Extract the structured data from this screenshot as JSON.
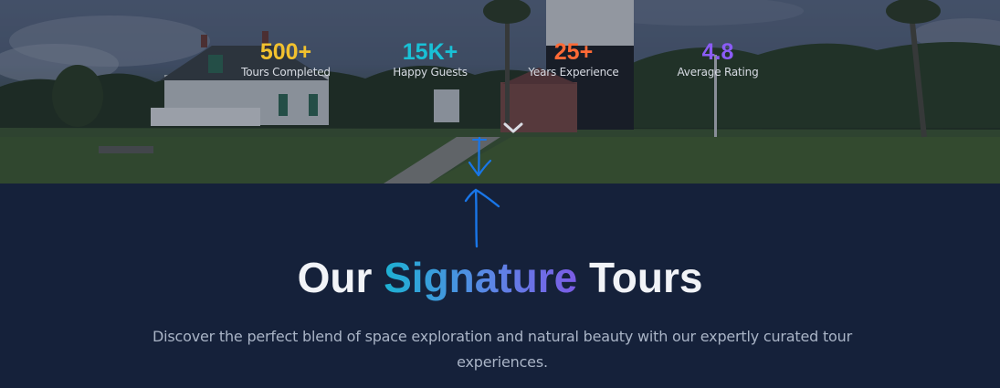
{
  "hero": {
    "stats": [
      {
        "value": "500+",
        "label": "Tours Completed",
        "color": "#f2c12e"
      },
      {
        "value": "15K+",
        "label": "Happy Guests",
        "color": "#19c1d6"
      },
      {
        "value": "25+",
        "label": "Years Experience",
        "color": "#ff6a36"
      },
      {
        "value": "4.8",
        "label": "Average Rating",
        "color": "#8b5cf6"
      }
    ],
    "scroll_icon": "chevron-down-icon"
  },
  "section": {
    "title_part1": "Our ",
    "title_accent": "Signature",
    "title_part2": " Tours",
    "subtitle": "Discover the perfect blend of space exploration and natural beauty with our expertly curated tour experiences."
  },
  "colors": {
    "background": "#15213a",
    "accent_start": "#1db1d3",
    "accent_end": "#7c5ce6",
    "annotation": "#1976e8"
  }
}
